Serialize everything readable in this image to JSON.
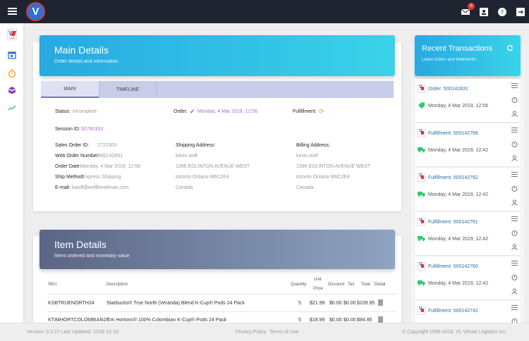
{
  "topbar": {
    "notifications_count": "0"
  },
  "main_details": {
    "title": "Main Details",
    "subtitle": "Order details and information",
    "tabs": [
      "MAIN",
      "TIMELINE"
    ],
    "status_label": "Status:",
    "status_value": "Incomplete",
    "order_label": "Order:",
    "order_value": "Monday, 4 Mar 2019, 12:56",
    "fulfillment_label": "Fulfillment:",
    "session_label": "Session ID:",
    "session_value": "92780333",
    "sales_order_label": "Sales Order ID:",
    "sales_order_value": "2722303",
    "web_order_label": "Web Order Number:",
    "web_order_value": "500142831",
    "order_date_label": "Order Date:",
    "order_date_value": "Monday, 4 Mar 2019, 12:56",
    "ship_method_label": "Ship Method:",
    "ship_method_value": "Express Shipping",
    "email_label": "E-mail:",
    "email_value": "kwolf@wolfkimelman.com",
    "shipping_label": "Shipping Address:",
    "billing_label": "Billing Address:",
    "address_name": "kevin wolf",
    "address_street": "1396 EGLINTON AVENUE WEST",
    "address_city": "toronto Ontario M6C2E4",
    "address_country": "Canada"
  },
  "item_details": {
    "title": "Item Details",
    "subtitle": "Items ordered and monetary value",
    "columns": {
      "sku": "SKU",
      "description": "Description",
      "quantity": "Quantity",
      "unit": "Unit",
      "price": "Price",
      "discount": "Discount",
      "tax": "Tax",
      "total": "Total",
      "detail": "Detail"
    },
    "rows": [
      {
        "sku": "KSBTRUENORTH24",
        "description": "Starbucks® True North (Veranda) Blend K-Cup® Pods 24 Pack",
        "quantity": "5",
        "price": "$21.99",
        "discount": "$0.00",
        "tax": "$0.00",
        "total": "$109.95"
      },
      {
        "sku": "KTIMHORTCOLOMBIAN24",
        "description": "Tim Hortons® 100% Colombian K-Cup® Pods 24 Pack",
        "quantity": "5",
        "price": "$18.99",
        "discount": "$0.00",
        "tax": "$0.00",
        "total": "$94.95"
      }
    ]
  },
  "recent_transactions": {
    "title": "Recent Transactions",
    "subtitle": "Latest orders and fulfillments",
    "items": [
      {
        "title": "Order: 500142831",
        "date": "Monday, 4 Mar 2019, 12:56"
      },
      {
        "title": "Fulfillment: 500142768",
        "date": "Monday, 4 Mar 2019, 12:42"
      },
      {
        "title": "Fulfillment: 500142762",
        "date": "Monday, 4 Mar 2019, 12:42"
      },
      {
        "title": "Fulfillment: 500142761",
        "date": "Monday, 4 Mar 2019, 12:42"
      },
      {
        "title": "Fulfillment: 500142760",
        "date": "Monday, 4 Mar 2019, 12:42"
      },
      {
        "title": "Fulfillment: 500142742",
        "date": ""
      }
    ]
  },
  "footer": {
    "version": "Version: 0.2.57 Last Updated: 2018-12-18",
    "privacy": "Privacy Policy",
    "terms": "Terms of Use",
    "copyright": "© Copyright 1996-2018, VL Virtual Logistics Inc."
  },
  "colors": {
    "topbar": "#1f2431",
    "header_blue": "#27a9e1",
    "header_gray": "#5b6586",
    "link_purple": "#b36bd6"
  }
}
